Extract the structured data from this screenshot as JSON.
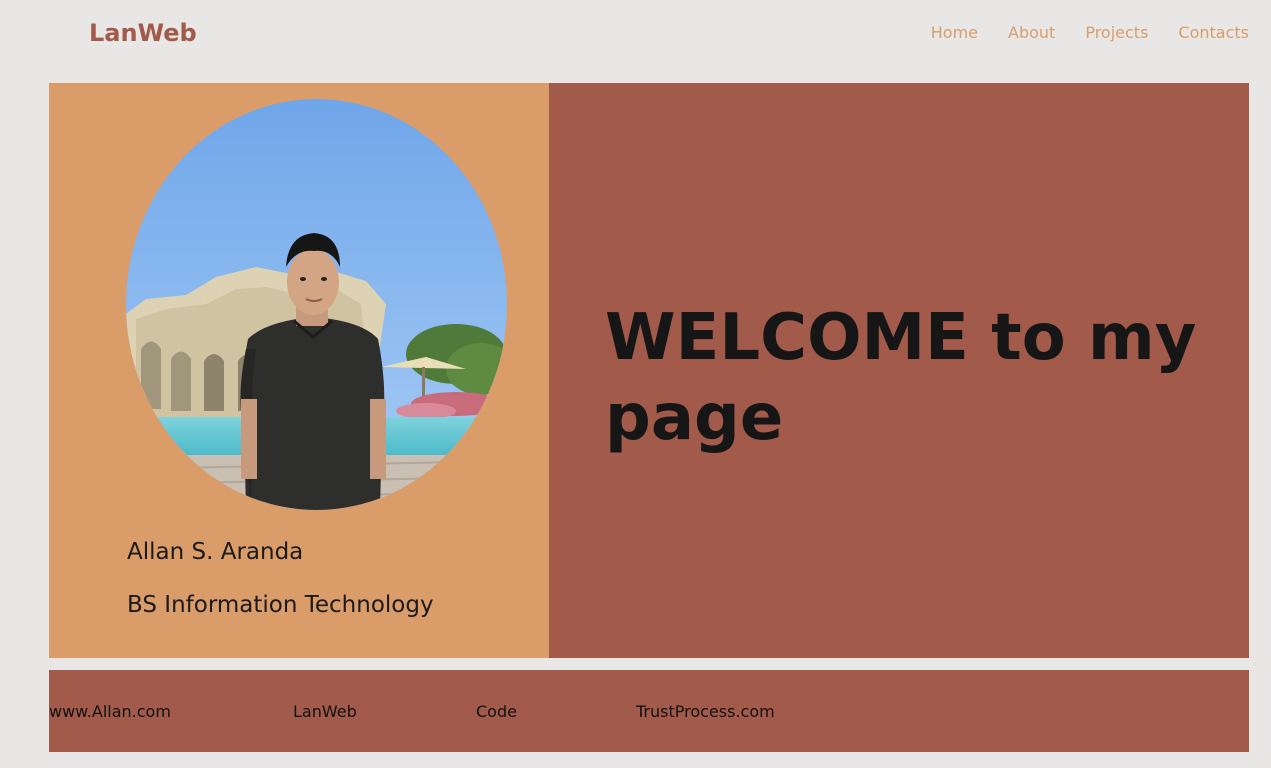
{
  "header": {
    "brand": "LanWeb",
    "nav": [
      "Home",
      "About",
      "Projects",
      "Contacts"
    ]
  },
  "profile": {
    "name": "Allan S. Aranda",
    "degree": "BS Information Technology"
  },
  "hero": {
    "welcome": "WELCOME to my page"
  },
  "footer": {
    "links": [
      "www.Allan.com",
      "LanWeb",
      "Code",
      "TrustProcess.com"
    ]
  },
  "colors": {
    "background": "#e8e7e6",
    "accent_orange": "#da9d6a",
    "accent_brown": "#a25a4b",
    "nav_text": "#d99d6c"
  }
}
